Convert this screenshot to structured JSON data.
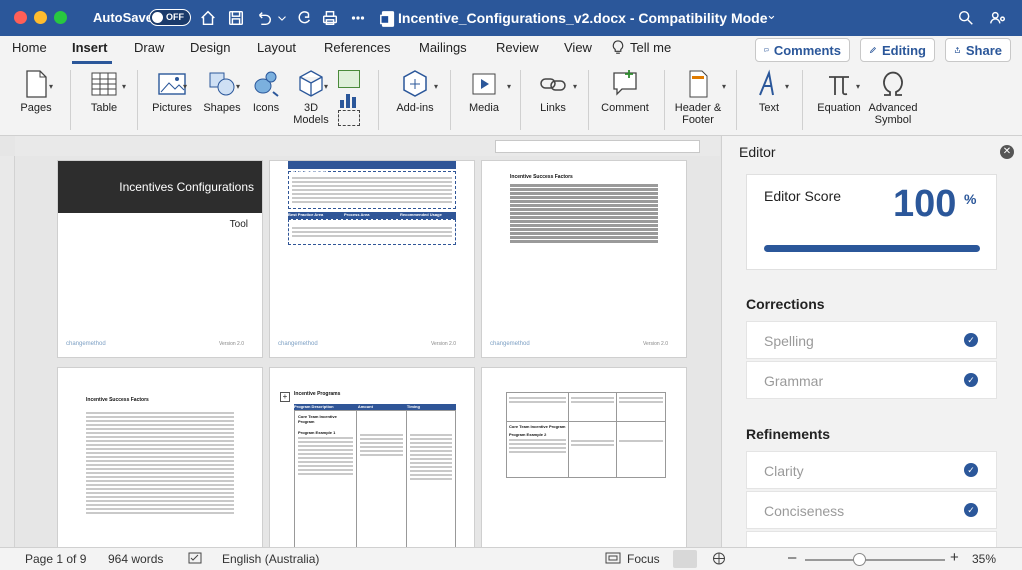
{
  "titlebar": {
    "autosave_label": "AutoSave",
    "autosave_state": "OFF",
    "document_title": "Incentive_Configurations_v2.docx  -  Compatibility Mode",
    "title_caret": "⌄"
  },
  "menu": {
    "tabs": [
      "Home",
      "Insert",
      "Draw",
      "Design",
      "Layout",
      "References",
      "Mailings",
      "Review",
      "View",
      "Tell me"
    ],
    "active_tab": "Insert",
    "comments_label": "Comments",
    "editing_label": "Editing",
    "share_label": "Share"
  },
  "ribbon": {
    "pages": "Pages",
    "table": "Table",
    "pictures": "Pictures",
    "shapes": "Shapes",
    "icons": "Icons",
    "models_3d": "3D Models",
    "addins": "Add-ins",
    "media": "Media",
    "links": "Links",
    "comment": "Comment",
    "header_footer": "Header & Footer",
    "text": "Text",
    "equation": "Equation",
    "advanced_symbol": "Advanced Symbol"
  },
  "document": {
    "cover_title": "Incentives Configurations",
    "cover_subtitle": "Tool",
    "logo_text": "changemethod",
    "version_text": "Version 2.0",
    "about_heading": "About this tool",
    "best_practice": "Best Practice Area",
    "process_area": "Process Area",
    "recommended": "Recommended Usage",
    "success_factors_heading": "Incentive Success Factors",
    "incentive_programs_heading": "Incentive Programs",
    "program_description": "Program Description",
    "amount": "Amount",
    "timing": "Timing",
    "core_team": "Core Team Incentive Program",
    "program_example_1": "Program Example 1",
    "program_example_2": "Program Example 2"
  },
  "editor": {
    "title": "Editor",
    "score_label": "Editor Score",
    "score_value": "100",
    "score_unit": "%",
    "score_fraction": 1.0,
    "corrections_heading": "Corrections",
    "spelling": "Spelling",
    "grammar": "Grammar",
    "refinements_heading": "Refinements",
    "clarity": "Clarity",
    "conciseness": "Conciseness"
  },
  "status": {
    "page": "Page 1 of 9",
    "words": "964 words",
    "language": "English (Australia)",
    "focus": "Focus",
    "zoom": "35%",
    "zoom_minus": "–",
    "zoom_plus": "+"
  },
  "colors": {
    "brand": "#2b579a",
    "close_red": "#ff5f57",
    "minimize_yellow": "#febc2e",
    "maximize_green": "#28c840"
  }
}
